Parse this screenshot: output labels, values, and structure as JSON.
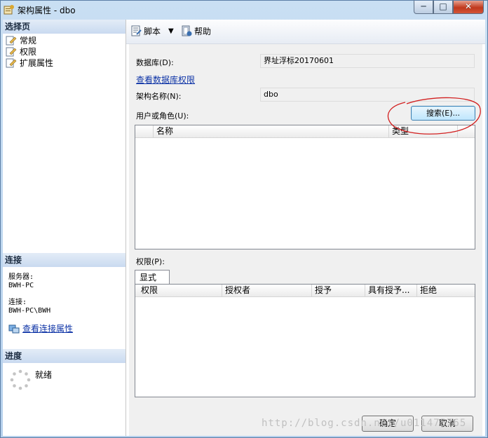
{
  "window": {
    "title": "架构属性 - dbo",
    "min_glyph": "─",
    "max_glyph": "□",
    "close_glyph": "✕"
  },
  "left_panel": {
    "select_page_header": "选择页",
    "pages": [
      {
        "label": "常规",
        "icon": "page-icon"
      },
      {
        "label": "权限",
        "icon": "page-icon"
      },
      {
        "label": "扩展属性",
        "icon": "page-icon"
      }
    ],
    "connection_header": "连接",
    "server_label": "服务器:",
    "server_value": "BWH-PC",
    "connection_label": "连接:",
    "connection_value": "BWH-PC\\BWH",
    "view_connection_link": "查看连接属性",
    "progress_header": "进度",
    "progress_status": "就绪"
  },
  "toolbar": {
    "script_label": "脚本",
    "help_label": "帮助"
  },
  "form": {
    "database_label": "数据库(D):",
    "database_value": "界址浮标20170601",
    "view_db_permissions_link": "查看数据库权限",
    "schema_name_label": "架构名称(N):",
    "schema_name_value": "dbo",
    "user_or_role_label": "用户或角色(U):",
    "search_button": "搜索(E)...",
    "users_columns": [
      "名称",
      "类型"
    ],
    "permissions_label": "权限(P):",
    "explicit_tab": "显式",
    "perm_columns": [
      "权限",
      "授权者",
      "授予",
      "具有授予...",
      "拒绝"
    ]
  },
  "footer": {
    "ok_button": "确定",
    "cancel_button": "取消"
  },
  "watermark": "http://blog.csdn.net/u011475765",
  "colors": {
    "link": "#0d33a6",
    "annotation_circle": "#d22020",
    "section_header": "#c9daf0"
  }
}
